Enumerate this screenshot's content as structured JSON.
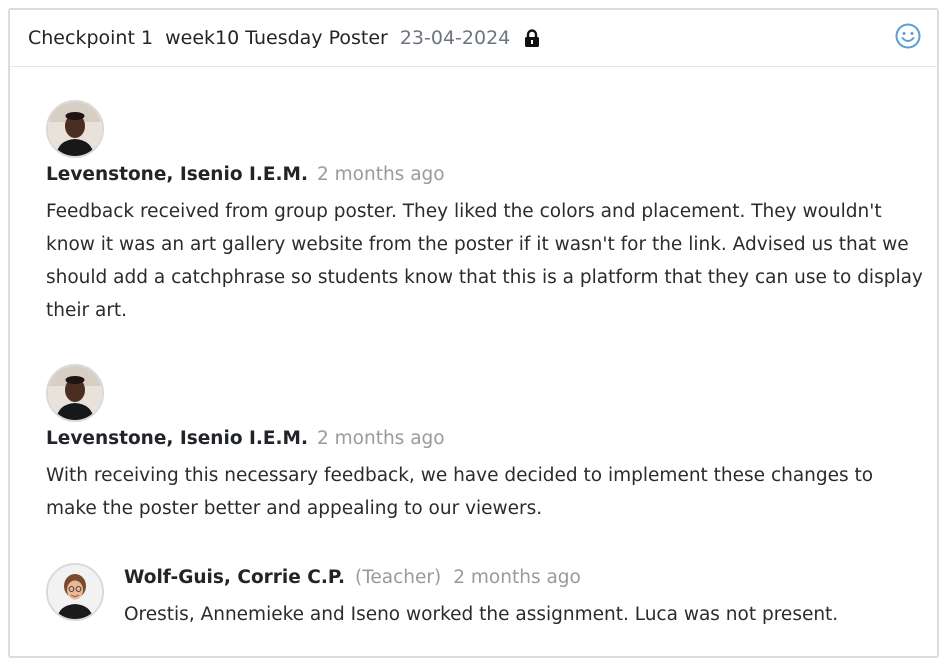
{
  "header": {
    "title": "Checkpoint 1  week10 Tuesday Poster",
    "date": "23-04-2024",
    "lock_icon": "lock-icon",
    "reaction_icon": "smiley-icon"
  },
  "comments": [
    {
      "author": "Levenstone, Isenio I.E.M.",
      "time": "2 months ago",
      "text": "Feedback received from group poster. They liked the colors and placement. They wouldn't know it was an art gallery website from the poster if it wasn't for the link. Advised us that we should add a catchphrase so students know that this is a platform that they can use to display their art."
    },
    {
      "author": "Levenstone, Isenio I.E.M.",
      "time": "2 months ago",
      "text": "With receiving this necessary feedback, we have decided to implement these changes to make the poster better and appealing to our viewers."
    },
    {
      "author": "Wolf-Guis, Corrie C.P.",
      "role": "(Teacher)",
      "time": "2 months ago",
      "text": "Orestis, Annemieke and Iseno worked the assignment. Luca was not present."
    }
  ],
  "colors": {
    "accent": "#5aa0d8",
    "muted": "#9a9a9a",
    "border": "#dcdcdc"
  }
}
